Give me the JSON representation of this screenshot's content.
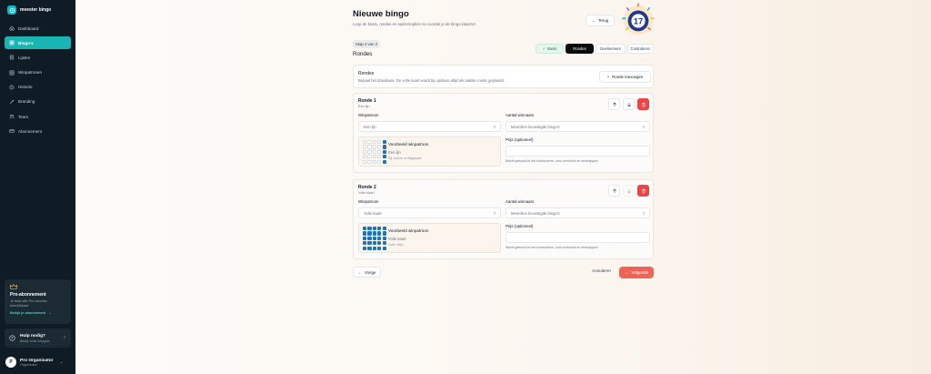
{
  "app": {
    "name": "meester bingo"
  },
  "sidebar": {
    "items": [
      {
        "label": "Dashboard",
        "icon": "home-icon",
        "active": false
      },
      {
        "label": "Bingo's",
        "icon": "grid-icon",
        "active": true
      },
      {
        "label": "Lijsten",
        "icon": "list-icon",
        "active": false
      },
      {
        "label": "Winpatronen",
        "icon": "pattern-icon",
        "active": false
      },
      {
        "label": "Historie",
        "icon": "history-icon",
        "active": false
      },
      {
        "label": "Branding",
        "icon": "palette-icon",
        "active": false
      },
      {
        "label": "Team",
        "icon": "team-icon",
        "active": false
      },
      {
        "label": "Abonnement",
        "icon": "card-icon",
        "active": false
      }
    ],
    "pro": {
      "title": "Pro-abonnement",
      "desc": "Je hebt alle Pro-functies beschikbaar.",
      "link": "Bekijk je abonnement"
    },
    "help": {
      "title": "Hulp nodig?",
      "sub": "Bekijk onze helpgids"
    },
    "user": {
      "initial": "P",
      "name": "Pro Organisator",
      "role": "Organisator"
    }
  },
  "header": {
    "title": "Nieuwe bingo",
    "subtitle": "Loop de basis, rondes en spelersopties na voordat je de bingo klaarzet.",
    "back_label": "Terug",
    "badge_number": "17"
  },
  "wizard": {
    "step": "Stap 2 van 4",
    "section": "Rondes",
    "tabs": [
      {
        "label": "Basis",
        "state": "done"
      },
      {
        "label": "Rondes",
        "state": "active"
      },
      {
        "label": "Deelnemers",
        "state": "todo"
      },
      {
        "label": "Controleren",
        "state": "todo"
      }
    ]
  },
  "rondes": {
    "title": "Rondes",
    "desc": "Bepaal het draaiboek. De volle kaart wordt bij opslaan altijd als laatste ronde geplaatst.",
    "add_label": "Ronde toevoegen"
  },
  "rounds": [
    {
      "title": "Ronde 1",
      "sub": "Een lijn",
      "winpatroon_label": "Winpatroon",
      "winpatroon_value": "Een lijn",
      "winners_label": "Aantal winnaars",
      "winners_value": "Meerdere bevestigde bingo's",
      "prize_label": "Prijs (optioneel)",
      "prize_hint": "Wordt getoond in het hostscherm, voor-overzicht en eindrapport.",
      "preview_title": "Voorbeeld winpatroon",
      "preview_name": "Een lijn",
      "preview_desc": "Rij, kolom of diagonaal"
    },
    {
      "title": "Ronde 2",
      "sub": "Volle kaart",
      "winpatroon_label": "Winpatroon",
      "winpatroon_value": "Volle kaart",
      "winners_label": "Aantal winnaars",
      "winners_value": "Meerdere bevestigde bingo's",
      "prize_label": "Prijs (optioneel)",
      "prize_hint": "Wordt getoond in het hostscherm, voor-overzicht en eindrapport.",
      "preview_title": "Voorbeeld winpatroon",
      "preview_name": "Volle kaart",
      "preview_desc": "Volle retijn"
    }
  ],
  "footer": {
    "prev_label": "Vorige",
    "cancel_label": "Annuleren",
    "next_label": "Volgende"
  },
  "colors": {
    "sidebar": "#0f1c26",
    "accent": "#19b5b3",
    "danger": "#ef4444",
    "primary_action": "#f06457",
    "pattern": "#1d73b8"
  }
}
